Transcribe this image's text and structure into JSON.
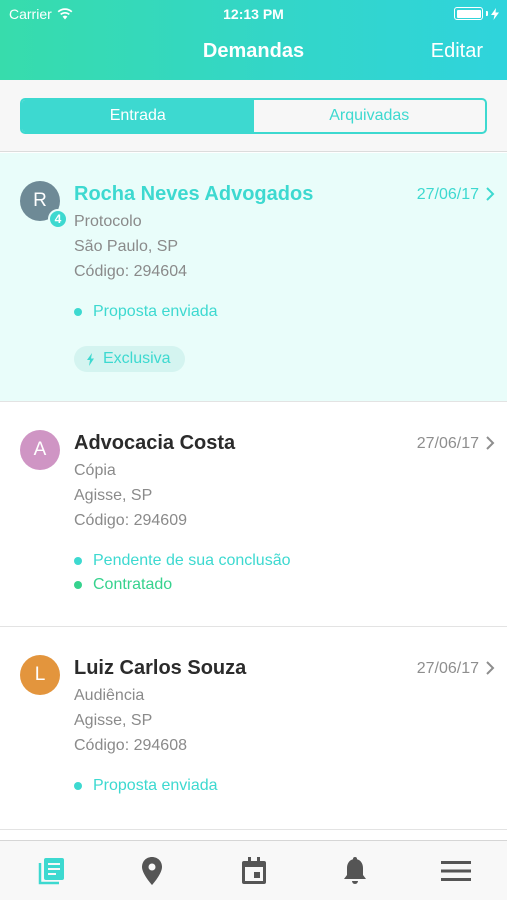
{
  "status_bar": {
    "carrier": "Carrier",
    "time": "12:13 PM"
  },
  "nav": {
    "title": "Demandas",
    "edit_label": "Editar"
  },
  "segments": [
    {
      "label": "Entrada",
      "active": true
    },
    {
      "label": "Arquivadas",
      "active": false
    }
  ],
  "cards": [
    {
      "avatar_letter": "R",
      "avatar_color": "#6e8a96",
      "badge": "4",
      "name": "Rocha Neves Advogados",
      "date": "27/06/17",
      "type": "Protocolo",
      "location": "São Paulo, SP",
      "code": "Código: 294604",
      "statuses": [
        {
          "text": "Proposta enviada",
          "color": "#3dd9d0"
        }
      ],
      "tag": "Exclusiva"
    },
    {
      "avatar_letter": "A",
      "avatar_color": "#cf95c4",
      "name": "Advocacia Costa",
      "date": "27/06/17",
      "type": "Cópia",
      "location": "Agisse, SP",
      "code": "Código: 294609",
      "statuses": [
        {
          "text": "Pendente de sua conclusão",
          "color": "#3dd9d0"
        },
        {
          "text": "Contratado",
          "color": "#36d28e"
        }
      ]
    },
    {
      "avatar_letter": "L",
      "avatar_color": "#e3953d",
      "name": "Luiz Carlos Souza",
      "date": "27/06/17",
      "type": "Audiência",
      "location": "Agisse, SP",
      "code": "Código: 294608",
      "statuses": [
        {
          "text": "Proposta enviada",
          "color": "#3dd9d0"
        }
      ]
    }
  ],
  "tabbar": {
    "items": [
      {
        "icon": "demands-list-icon",
        "active": true
      },
      {
        "icon": "location-pin-icon",
        "active": false
      },
      {
        "icon": "calendar-icon",
        "active": false
      },
      {
        "icon": "bell-icon",
        "active": false
      },
      {
        "icon": "menu-icon",
        "active": false
      }
    ],
    "active_color": "#3dd9d0",
    "inactive_color": "#555555"
  }
}
